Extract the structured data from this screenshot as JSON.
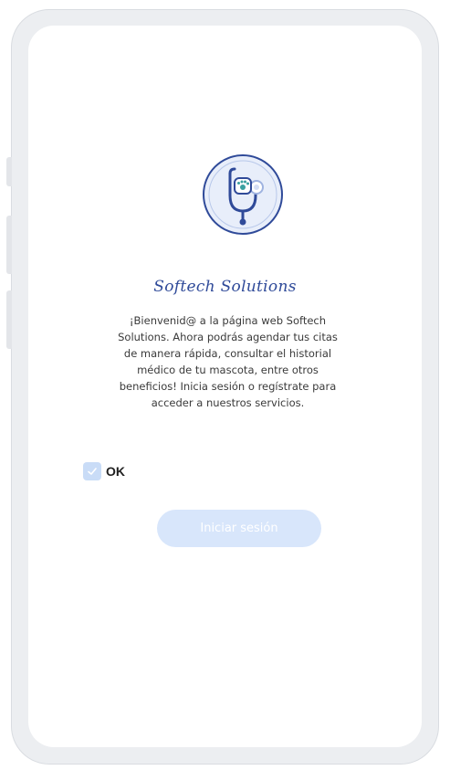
{
  "brand": {
    "name": "Softech Solutions",
    "accent_color": "#2f4a99",
    "logo_icon": "stethoscope-paw-icon"
  },
  "welcome": {
    "line1": "¡Bienvenid@ a la página web Softech",
    "line2": "Solutions. Ahora podrás agendar tus citas",
    "line3": "de manera rápida, consultar el historial",
    "line4": "médico de tu mascota, entre otros",
    "line5": "beneficios! Inicia sesión o regístrate para",
    "line6": "acceder a nuestros servicios."
  },
  "ok_checkbox": {
    "label": "OK",
    "checked": true,
    "color": "#c9dcf7"
  },
  "login_button": {
    "label": "Iniciar sesión",
    "state": "disabled",
    "color": "#d8e6fb"
  }
}
